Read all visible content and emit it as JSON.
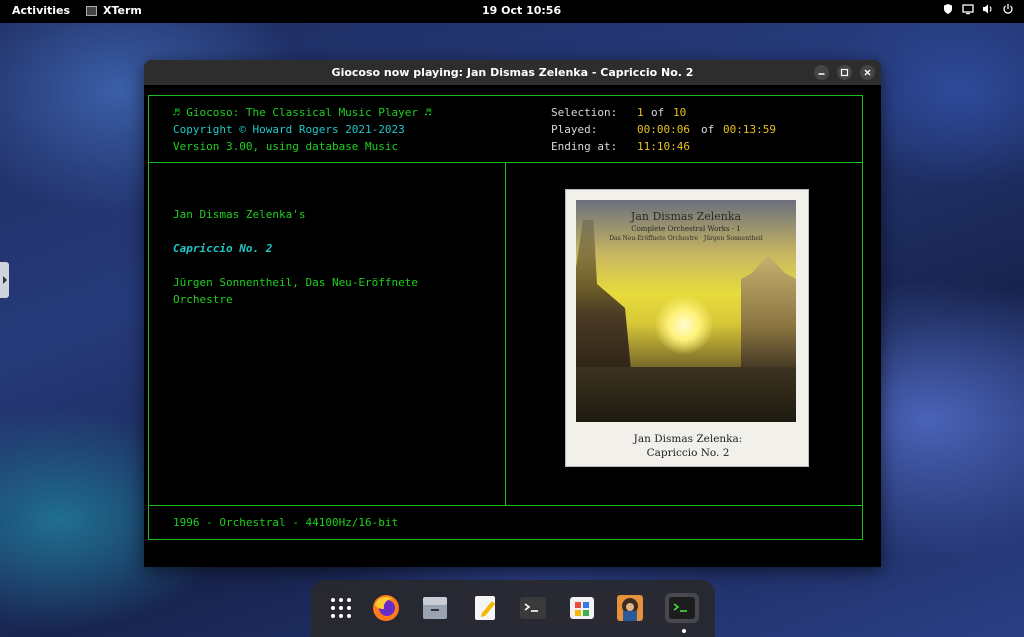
{
  "topbar": {
    "activities": "Activities",
    "app_name": "XTerm",
    "clock": "19 Oct  10:56",
    "tray_icons": [
      "shield-icon",
      "display-icon",
      "volume-icon",
      "power-icon"
    ]
  },
  "window": {
    "title": "Giocoso now playing: Jan Dismas Zelenka - Capriccio No. 2",
    "buttons": [
      "minimize",
      "maximize",
      "close"
    ]
  },
  "header": {
    "line1": "♬ Giocoso: The Classical Music Player ♬",
    "line2": "Copyright © Howard Rogers 2021-2023",
    "line3": "Version 3.00, using database Music",
    "selection_label": "Selection:",
    "selection_current": "1",
    "selection_of": "of",
    "selection_total": "10",
    "played_label": "Played:",
    "played_time": "00:00:06",
    "played_of": "of",
    "total_time": "00:13:59",
    "ending_label": "Ending at:",
    "ending_time": "11:10:46"
  },
  "track": {
    "composer_line": "Jan Dismas Zelenka's",
    "work": "Capriccio No. 2",
    "performers_line1": "Jürgen Sonnentheil, Das Neu-Eröffnete",
    "performers_line2": "Orchestre"
  },
  "album": {
    "cover_title": "Jan Dismas Zelenka",
    "cover_subtitle": "Complete Orchestral Works · 1",
    "cover_performers": "Das Neu-Eröffnete Orchestre · Jürgen Sonnentheil",
    "caption_line1": "Jan Dismas Zelenka:",
    "caption_line2": "Capriccio No. 2"
  },
  "footer": {
    "info": "1996 - Orchestral - 44100Hz/16-bit"
  },
  "dock": {
    "items": [
      "app-grid",
      "firefox",
      "files",
      "text-editor",
      "terminal",
      "software",
      "giocoso",
      "xterm"
    ]
  },
  "colors": {
    "border_green": "#1fbf1f",
    "text_green": "#1fd11f",
    "text_cyan": "#1fc7c7",
    "text_yellow": "#e6c21f"
  }
}
